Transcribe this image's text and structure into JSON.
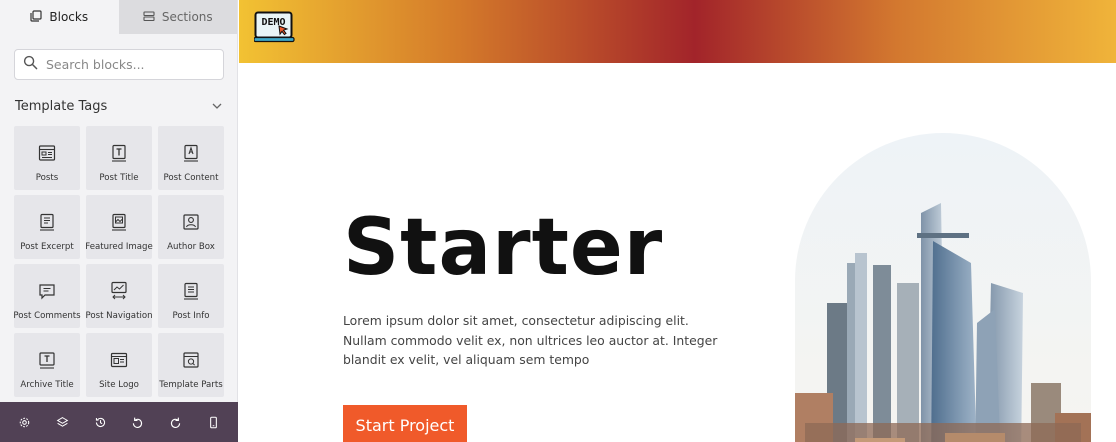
{
  "sidebar": {
    "tabs": [
      {
        "label": "Blocks",
        "icon": "blocks-icon"
      },
      {
        "label": "Sections",
        "icon": "sections-icon"
      }
    ],
    "search": {
      "placeholder": "Search blocks..."
    },
    "section": {
      "title": "Template Tags"
    },
    "blocks": [
      {
        "label": "Posts",
        "icon": "posts-icon"
      },
      {
        "label": "Post Title",
        "icon": "post-title-icon"
      },
      {
        "label": "Post Content",
        "icon": "post-content-icon"
      },
      {
        "label": "Post Excerpt",
        "icon": "post-excerpt-icon"
      },
      {
        "label": "Featured Image",
        "icon": "featured-image-icon"
      },
      {
        "label": "Author Box",
        "icon": "author-box-icon"
      },
      {
        "label": "Post Comments",
        "icon": "post-comments-icon"
      },
      {
        "label": "Post Navigation",
        "icon": "post-navigation-icon"
      },
      {
        "label": "Post Info",
        "icon": "post-info-icon"
      },
      {
        "label": "Archive Title",
        "icon": "archive-title-icon"
      },
      {
        "label": "Site Logo",
        "icon": "site-logo-icon"
      },
      {
        "label": "Template Parts",
        "icon": "template-parts-icon"
      }
    ],
    "footer_icons": [
      "settings-icon",
      "layers-icon",
      "history-icon",
      "undo-icon",
      "redo-icon",
      "mobile-preview-icon"
    ]
  },
  "header": {
    "logo_text": "DEMO"
  },
  "hero": {
    "title": "Starter",
    "text": "Lorem ipsum dolor sit amet, consectetur adipiscing elit. Nullam commodo velit ex, non ultrices leo auctor at. Integer blandit ex velit, vel aliquam sem tempo",
    "button": "Start Project"
  },
  "colors": {
    "accent": "#f05a2a",
    "sidebar_footer": "#514155",
    "sidebar_bg": "#f3f3f5"
  }
}
